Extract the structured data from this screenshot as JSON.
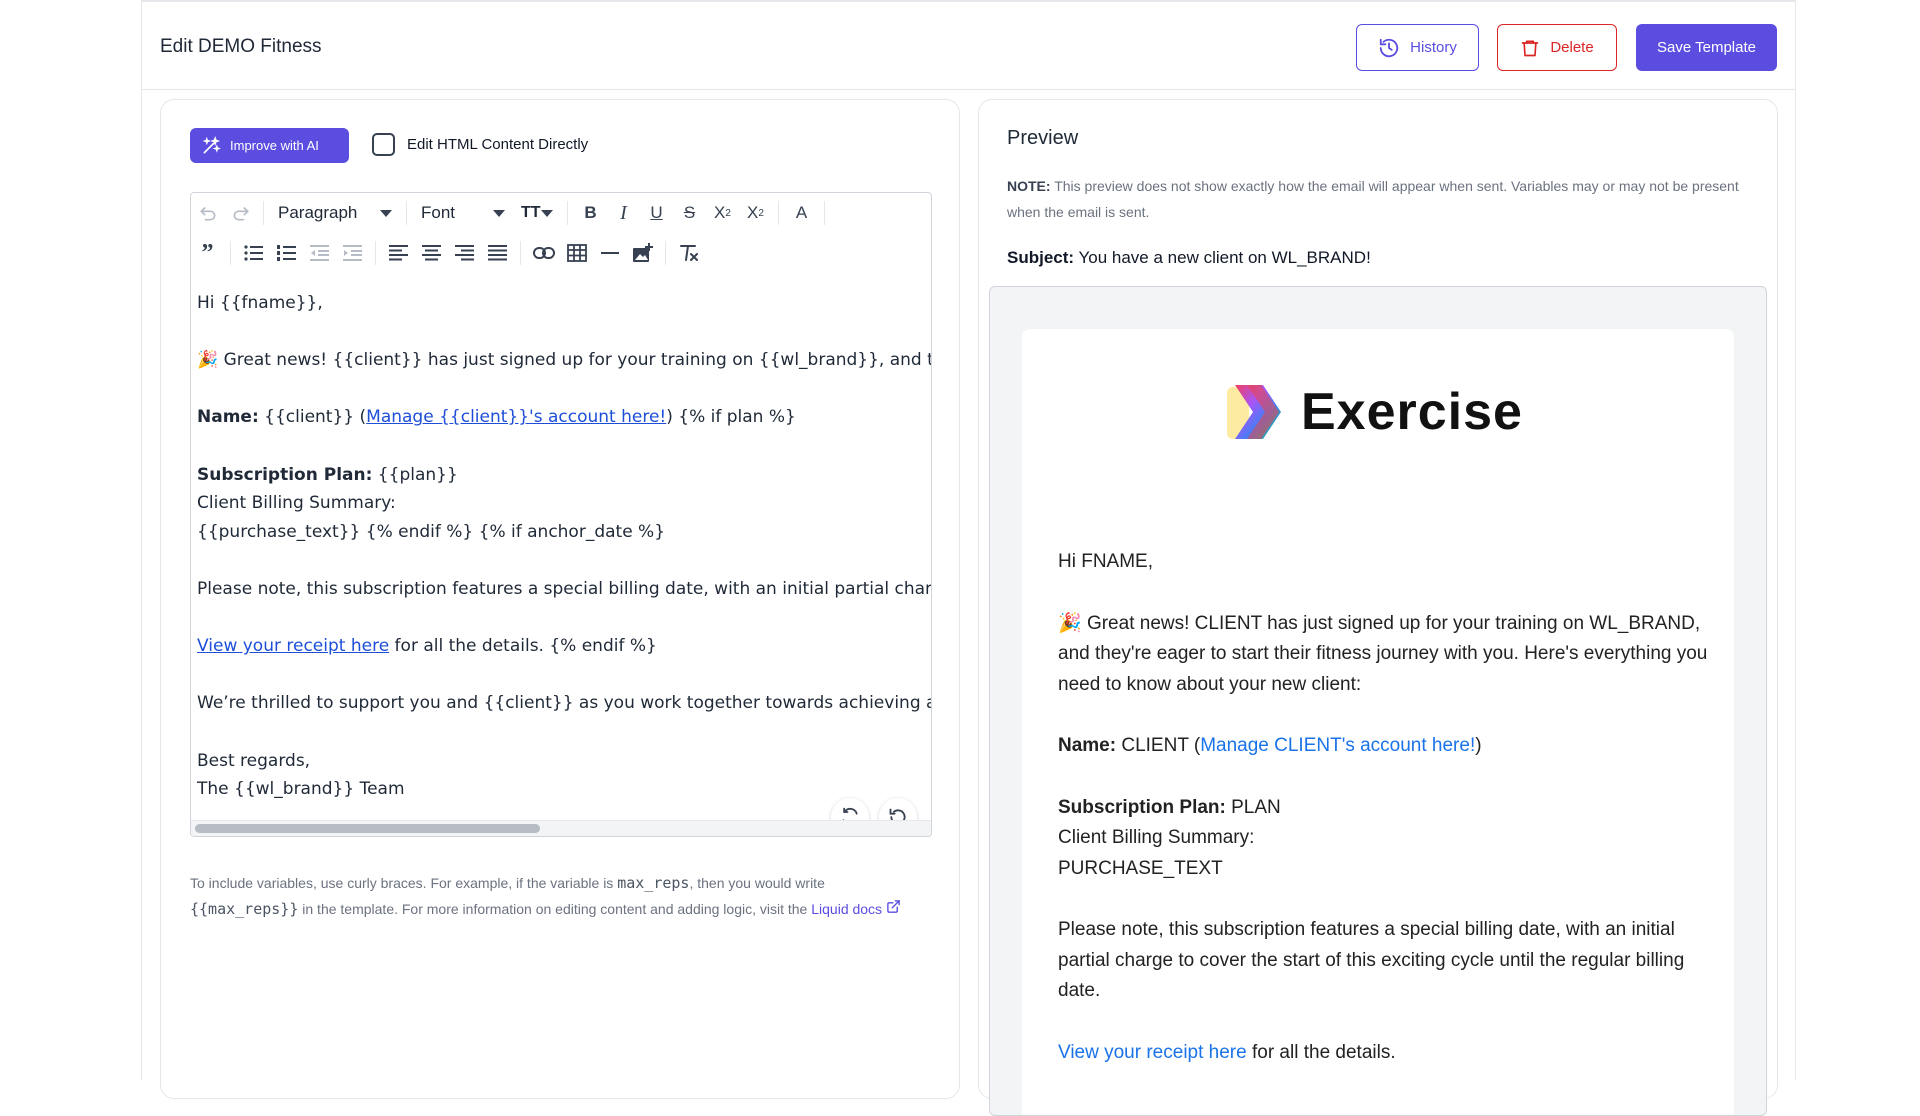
{
  "header": {
    "title": "Edit DEMO Fitness",
    "history_label": "History",
    "delete_label": "Delete",
    "save_label": "Save Template"
  },
  "editor": {
    "ai_button_label": "Improve with AI",
    "html_toggle_label": "Edit HTML Content Directly",
    "html_toggle_checked": false,
    "block_format": "Paragraph",
    "font": "Font",
    "font_size_icon": "TT",
    "content": {
      "greeting": "Hi {{fname}},",
      "news_emoji": "🎉",
      "news_text": " Great news! {{client}} has just signed up for your training on {{wl_brand}}, and they're eager to start their fitness journey with you.",
      "name_label": "Name:",
      "name_value": " {{client}} (",
      "name_link": "Manage {{client}}'s account here!",
      "name_tail": ") {% if plan %}",
      "plan_label": "Subscription Plan:",
      "plan_value": " {{plan}}",
      "billing_label": "Client Billing Summary:",
      "purchase_line": "{{purchase_text}} {% endif %} {% if anchor_date %}",
      "special_billing": "Please note, this subscription features a special billing date, with an initial partial charge to cover the start of this exciting cycle.",
      "receipt_link": "View your receipt here",
      "receipt_tail": " for all the details. {% endif %}",
      "thrilled": "We’re thrilled to support you and {{client}} as you work together towards achieving amazing results.",
      "regards": "Best regards,",
      "team": "The {{wl_brand}} Team"
    },
    "help": {
      "text1": "To include variables, use curly braces. For example, if the variable is ",
      "var_example": "max_reps",
      "text2": ", then you would write ",
      "var_template": "{{max_reps}}",
      "text3": " in the template. For more information on editing content and adding logic, visit the ",
      "docs_link": "Liquid docs"
    }
  },
  "preview": {
    "title": "Preview",
    "note_label": "NOTE:",
    "note_text": " This preview does not show exactly how the email will appear when sent. Variables may or may not be present when the email is sent.",
    "subject_label": "Subject:",
    "subject_value": " You have a new client on WL_BRAND!",
    "brand_name": "Exercise",
    "email": {
      "greeting": "Hi FNAME,",
      "news_emoji": "🎉",
      "news_text": " Great news! CLIENT has just signed up for your training on WL_BRAND, and they're eager to start their fitness journey with you. Here's everything you need to know about your new client:",
      "name_label": "Name:",
      "name_value": " CLIENT (",
      "name_link": "Manage CLIENT's account here!",
      "name_tail": ")",
      "plan_label": "Subscription Plan:",
      "plan_value": " PLAN",
      "billing_label": "Client Billing Summary:",
      "purchase": "PURCHASE_TEXT",
      "special_billing": "Please note, this subscription features a special billing date, with an initial partial charge to cover the start of this exciting cycle until the regular billing date.",
      "receipt_link": "View your receipt here",
      "receipt_tail": " for all the details."
    }
  },
  "colors": {
    "accent": "#5b4de0",
    "danger": "#dc2626",
    "link": "#1d4ed8"
  },
  "icons": [
    "history-icon",
    "trash-icon",
    "magic-wand-icon",
    "undo-icon",
    "redo-icon",
    "bold-icon",
    "italic-icon",
    "underline-icon",
    "strikethrough-icon",
    "subscript-icon",
    "superscript-icon",
    "text-color-icon",
    "blockquote-icon",
    "bullet-list-icon",
    "numbered-list-icon",
    "outdent-icon",
    "indent-icon",
    "align-left-icon",
    "align-center-icon",
    "align-right-icon",
    "align-justify-icon",
    "link-icon",
    "table-icon",
    "horizontal-rule-icon",
    "image-icon",
    "clear-format-icon",
    "refresh-icon",
    "reset-icon",
    "external-link-icon"
  ]
}
